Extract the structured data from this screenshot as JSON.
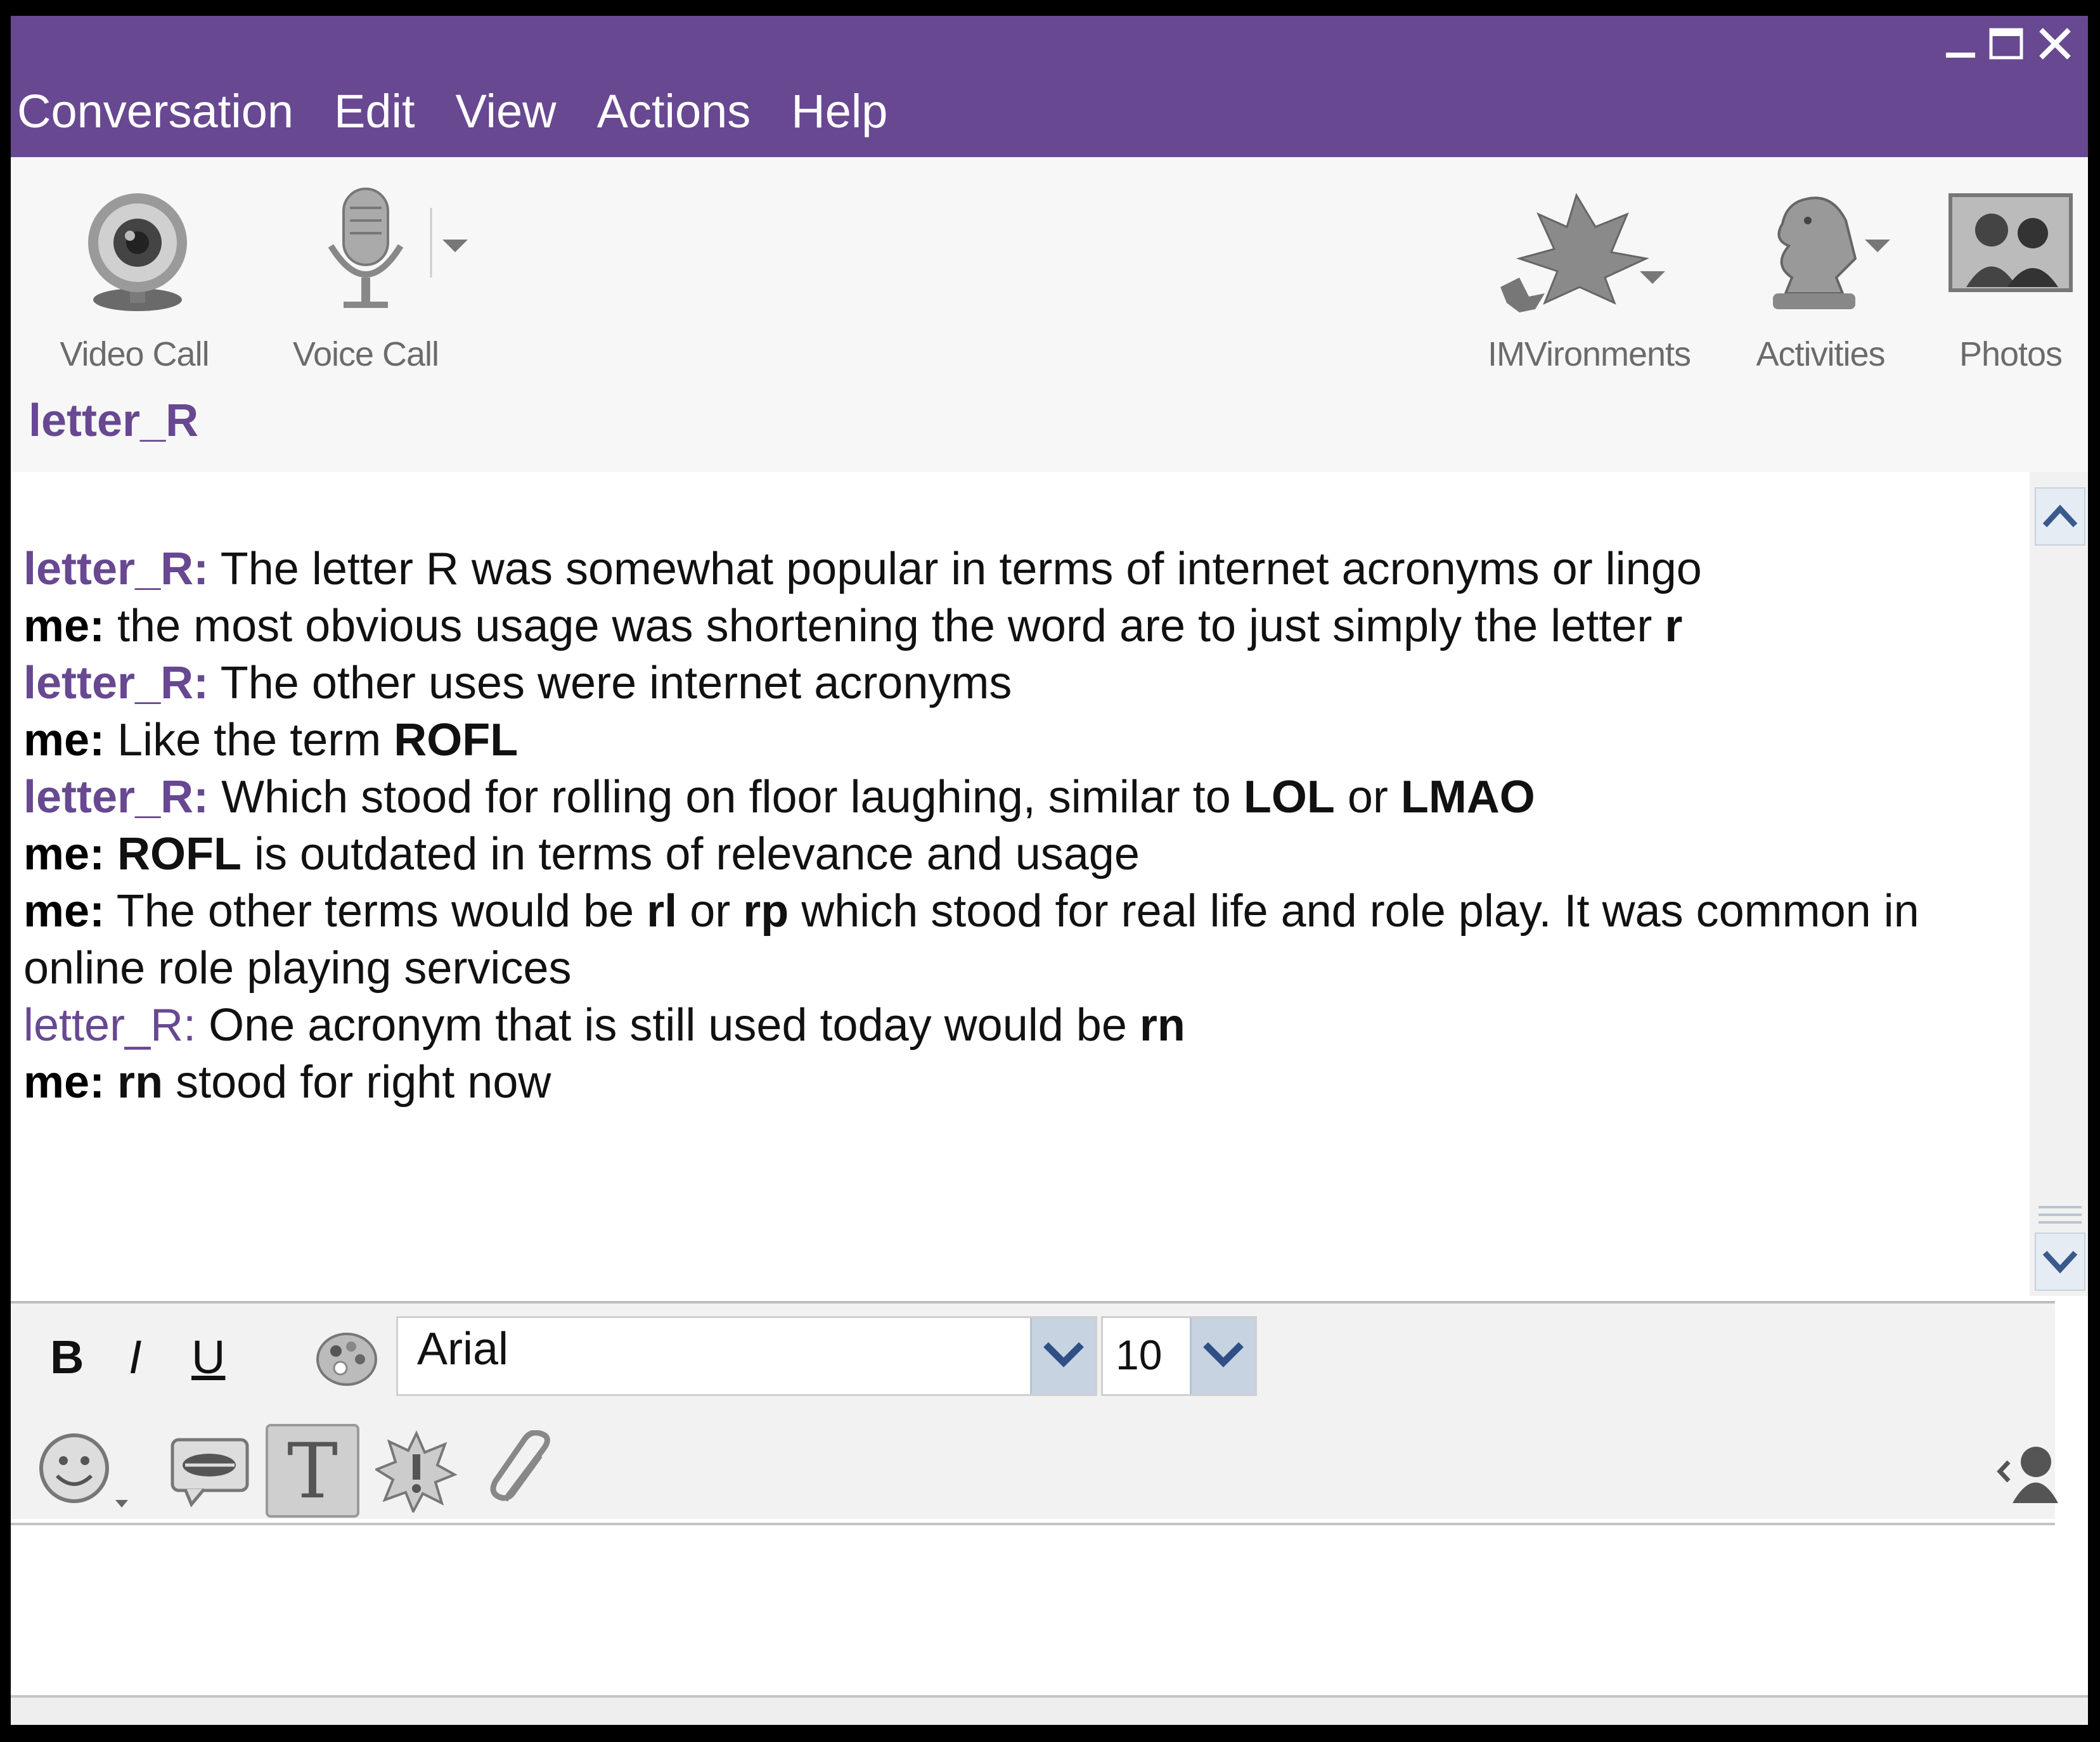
{
  "window_controls": {
    "minimize_icon": "minimize-icon",
    "maximize_icon": "maximize-icon",
    "close_icon": "close-icon"
  },
  "menu": [
    {
      "label": "Conversation"
    },
    {
      "label": "Edit"
    },
    {
      "label": "View"
    },
    {
      "label": "Actions"
    },
    {
      "label": "Help"
    }
  ],
  "toolbar": {
    "video_call": "Video Call",
    "voice_call": "Voice Call",
    "imvironments": "IMVironments",
    "activities": "Activities",
    "photos": "Photos"
  },
  "contact": {
    "name": "letter_R"
  },
  "conversation": {
    "m1": {
      "sender": "letter_R:",
      "t1": " The letter R was somewhat popular in terms of internet acronyms or lingo"
    },
    "m2": {
      "sender": "me:",
      "t1": " the most obvious usage was shortening the word are to just simply the letter ",
      "b1": "r"
    },
    "m3": {
      "sender": "letter_R:",
      "t1": " The other uses were internet acronyms"
    },
    "m4": {
      "sender": "me:",
      "t1": " Like the term ",
      "b1": "ROFL"
    },
    "m5": {
      "sender": "letter_R:",
      "t1": " Which stood for rolling on floor laughing, similar to ",
      "b1": "LOL",
      "t2": " or ",
      "b2": "LMAO"
    },
    "m6": {
      "sender": "me:",
      "b1": " ROFL",
      "t1": " is outdated in terms of relevance and usage"
    },
    "m7": {
      "sender": "me:",
      "t1": " The other terms would be ",
      "b1": "rl",
      "t2": " or ",
      "b2": "rp",
      "t3": " which stood for real life and role play. It was common in online role playing services"
    },
    "m8": {
      "sender": "letter_R:",
      "t1": " One acronym that is still used today would be ",
      "b1": "rn"
    },
    "m9": {
      "sender": "me:",
      "b1": " rn",
      "t1": " stood for right now"
    }
  },
  "format": {
    "bold": "B",
    "italic": "I",
    "underline": "U",
    "font": "Arial",
    "size": "10"
  },
  "colors": {
    "accent": "#674891",
    "dropdown": "#c7d3e0"
  }
}
